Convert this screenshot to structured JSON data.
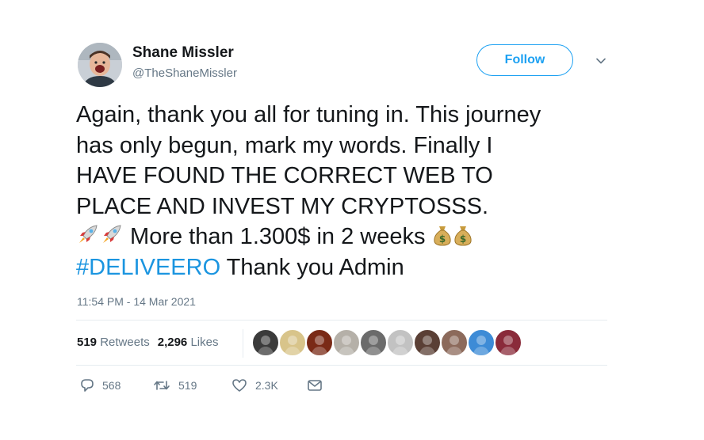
{
  "user": {
    "name": "Shane Missler",
    "handle": "@TheShaneMissler",
    "follow_label": "Follow"
  },
  "tweet": {
    "lines": [
      "Again, thank you all for tuning in. This journey",
      "has only begun, mark my words. Finally I",
      "HAVE FOUND THE CORRECT WEB TO",
      "PLACE AND INVEST MY CRYPTOSSS."
    ],
    "line5_text": " More than 1.300$ in 2 weeks ",
    "hashtag": "#DELIVEERO",
    "line6_rest": " Thank you Admin",
    "timestamp": "11:54 PM - 14 Mar 2021"
  },
  "stats": {
    "retweets_count": "519",
    "retweets_label": "Retweets",
    "likes_count": "2,296",
    "likes_label": "Likes"
  },
  "liker_avatars": [
    {
      "name": "liker-avatar-1",
      "color": "#3b3b3b"
    },
    {
      "name": "liker-avatar-2",
      "color": "#d8c48a"
    },
    {
      "name": "liker-avatar-3",
      "color": "#7a2a16"
    },
    {
      "name": "liker-avatar-4",
      "color": "#b5b0a8"
    },
    {
      "name": "liker-avatar-5",
      "color": "#6b6b6b"
    },
    {
      "name": "liker-avatar-6",
      "color": "#c2c2c2"
    },
    {
      "name": "liker-avatar-7",
      "color": "#5a3f35"
    },
    {
      "name": "liker-avatar-8",
      "color": "#8c6a5b"
    },
    {
      "name": "liker-avatar-9",
      "color": "#3d8bd6"
    },
    {
      "name": "liker-avatar-10",
      "color": "#8a2b3a"
    }
  ],
  "actions": {
    "replies": "568",
    "retweets": "519",
    "likes": "2.3K"
  },
  "colors": {
    "accent": "#1da1f2",
    "hashtag": "#1b95e0",
    "secondary_text": "#657786"
  },
  "icons": {
    "reply": "reply-icon",
    "retweet": "retweet-icon",
    "like": "heart-icon",
    "dm": "envelope-icon",
    "rocket": "rocket-icon",
    "money_bag": "money-bag-icon",
    "chevron": "chevron-down-icon"
  }
}
